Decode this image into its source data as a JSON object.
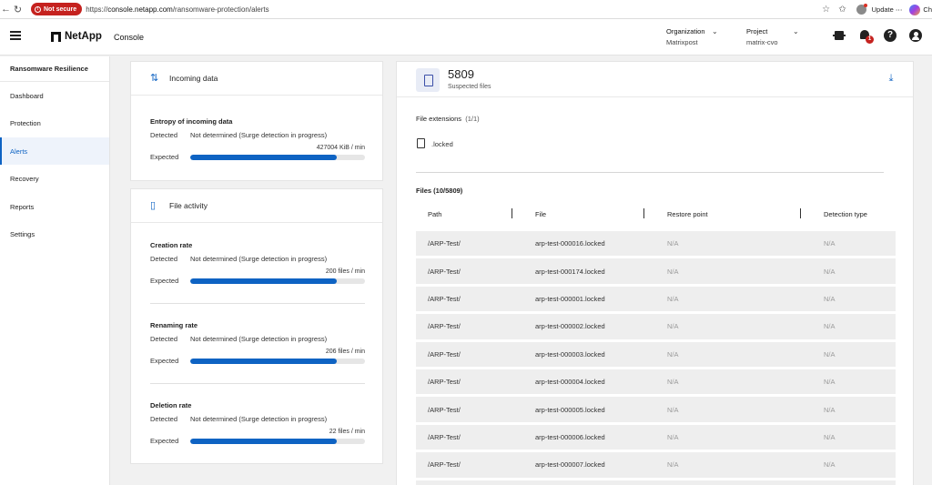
{
  "browser": {
    "security_label": "Not secure",
    "url_prefix": "https://",
    "url_host": "console.netapp.com",
    "url_path": "/ransomware-protection/alerts",
    "update_label": "Update",
    "more_label": "⋯",
    "copilot_label": "Ch"
  },
  "header": {
    "brand": "NetApp",
    "app": "Console",
    "organization_label": "Organization",
    "organization_value": "Matrixpost",
    "project_label": "Project",
    "project_value": "matrix-cvo",
    "notification_count": "1",
    "help_symbol": "?"
  },
  "sidebar": {
    "title": "Ransomware Resilience",
    "items": [
      {
        "label": "Dashboard"
      },
      {
        "label": "Protection"
      },
      {
        "label": "Alerts"
      },
      {
        "label": "Recovery"
      },
      {
        "label": "Reports"
      },
      {
        "label": "Settings"
      }
    ]
  },
  "incoming": {
    "title": "Incoming data",
    "metric": {
      "title": "Entropy of incoming data",
      "detected_label": "Detected",
      "detected_value": "Not determined (Surge detection in progress)",
      "rate": "427004 KiB / min",
      "expected_label": "Expected",
      "expected_level": 0.84
    }
  },
  "file_activity": {
    "title": "File activity",
    "metrics": [
      {
        "title": "Creation rate",
        "detected_label": "Detected",
        "detected_value": "Not determined (Surge detection in progress)",
        "rate": "200 files / min",
        "expected_label": "Expected",
        "expected_level": 0.84
      },
      {
        "title": "Renaming rate",
        "detected_label": "Detected",
        "detected_value": "Not determined (Surge detection in progress)",
        "rate": "206 files / min",
        "expected_label": "Expected",
        "expected_level": 0.84
      },
      {
        "title": "Deletion rate",
        "detected_label": "Detected",
        "detected_value": "Not determined (Surge detection in progress)",
        "rate": "22 files / min",
        "expected_label": "Expected",
        "expected_level": 0.84
      }
    ]
  },
  "suspected": {
    "count": "5809",
    "label": "Suspected files",
    "extensions_label": "File extensions",
    "extensions_count": "(1/1)",
    "extension": ".locked",
    "files_label": "Files (10/5809)",
    "columns": [
      "Path",
      "File",
      "Restore point",
      "Detection type"
    ],
    "rows": [
      {
        "path": "/ARP-Test/",
        "file": "arp-test-000016.locked",
        "restore": "N/A",
        "detection": "N/A"
      },
      {
        "path": "/ARP-Test/",
        "file": "arp-test-000174.locked",
        "restore": "N/A",
        "detection": "N/A"
      },
      {
        "path": "/ARP-Test/",
        "file": "arp-test-000001.locked",
        "restore": "N/A",
        "detection": "N/A"
      },
      {
        "path": "/ARP-Test/",
        "file": "arp-test-000002.locked",
        "restore": "N/A",
        "detection": "N/A"
      },
      {
        "path": "/ARP-Test/",
        "file": "arp-test-000003.locked",
        "restore": "N/A",
        "detection": "N/A"
      },
      {
        "path": "/ARP-Test/",
        "file": "arp-test-000004.locked",
        "restore": "N/A",
        "detection": "N/A"
      },
      {
        "path": "/ARP-Test/",
        "file": "arp-test-000005.locked",
        "restore": "N/A",
        "detection": "N/A"
      },
      {
        "path": "/ARP-Test/",
        "file": "arp-test-000006.locked",
        "restore": "N/A",
        "detection": "N/A"
      },
      {
        "path": "/ARP-Test/",
        "file": "arp-test-000007.locked",
        "restore": "N/A",
        "detection": "N/A"
      }
    ]
  },
  "colors": {
    "accent": "#0e63c3",
    "danger": "#c5221f"
  }
}
